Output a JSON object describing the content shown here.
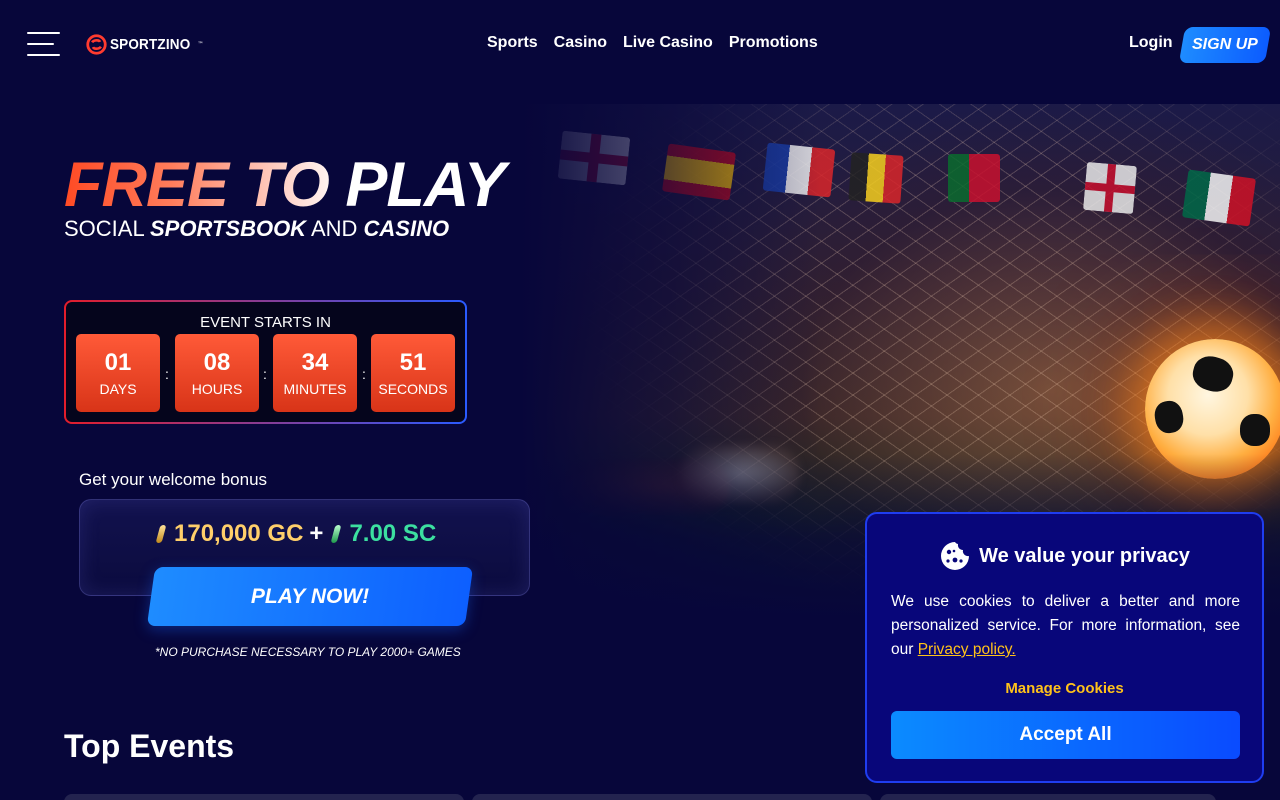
{
  "header": {
    "logo_text": "SPORTZINO",
    "logo_tm": "™",
    "nav": [
      "Sports",
      "Casino",
      "Live Casino",
      "Promotions"
    ],
    "login_label": "Login",
    "signup_label": "SIGN UP"
  },
  "hero": {
    "headline_part1": "FREE ",
    "headline_part2a": "TO ",
    "headline_part2b": "PLAY",
    "sub_prefix": "SOCIAL ",
    "sub_bold1": "SPORTSBOOK",
    "sub_mid": " AND ",
    "sub_bold2": "CASINO"
  },
  "countdown": {
    "title": "EVENT STARTS IN",
    "units": [
      {
        "value": "01",
        "label": "DAYS"
      },
      {
        "value": "08",
        "label": "HOURS"
      },
      {
        "value": "34",
        "label": "MINUTES"
      },
      {
        "value": "51",
        "label": "SECONDS"
      }
    ],
    "separator": ":"
  },
  "bonus": {
    "welcome_text": "Get your welcome bonus",
    "gc_amount": "170,000 GC",
    "plus": "+",
    "sc_amount": "7.00 SC",
    "play_label": "PLAY NOW!",
    "disclaimer": "*NO PURCHASE NECESSARY TO PLAY 2000+ GAMES"
  },
  "sections": {
    "top_events_title": "Top Events"
  },
  "cookie_banner": {
    "title": "We value your privacy",
    "body": "We use cookies to deliver a better and more personalized service. For more information, see our ",
    "policy_link": "Privacy policy.",
    "manage_label": "Manage Cookies",
    "accept_label": "Accept All"
  },
  "colors": {
    "background": "#07063a",
    "accent_blue": "#0d5fff",
    "accent_orange": "#ff4a24",
    "gc_gold": "#ffcf6a",
    "sc_green": "#3ce0a0",
    "link_yellow": "#ffc21a"
  },
  "icons": {
    "menu": "hamburger-icon",
    "logo": "sportzino-logo-icon",
    "cookie": "cookie-icon"
  }
}
